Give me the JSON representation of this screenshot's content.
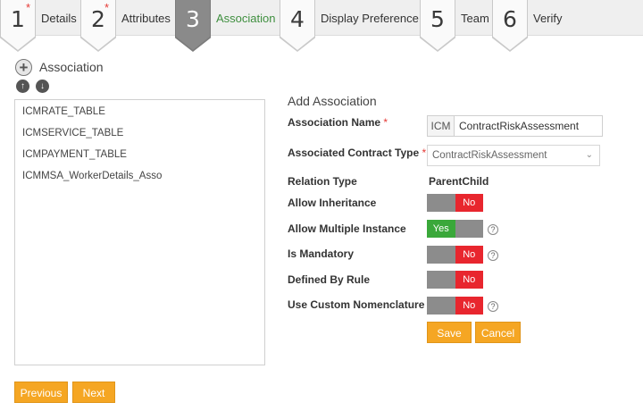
{
  "wizard": {
    "steps": [
      {
        "num": "1",
        "label": "Details",
        "required": "*"
      },
      {
        "num": "2",
        "label": "Attributes",
        "required": "*"
      },
      {
        "num": "3",
        "label": "Association",
        "required": ""
      },
      {
        "num": "4",
        "label": "Display Preference",
        "required": ""
      },
      {
        "num": "5",
        "label": "Team",
        "required": ""
      },
      {
        "num": "6",
        "label": "Verify",
        "required": ""
      }
    ],
    "active_step": "3"
  },
  "left_panel": {
    "title": "Association",
    "add_icon": "plus-circle-icon",
    "move_up_icon": "arrow-up-icon",
    "move_down_icon": "arrow-down-icon",
    "items": [
      "ICMRATE_TABLE",
      "ICMSERVICE_TABLE",
      "ICMPAYMENT_TABLE",
      "ICMMSA_WorkerDetails_Asso"
    ]
  },
  "form": {
    "title": "Add Association",
    "required_marker": "*",
    "association_name": {
      "label": "Association Name",
      "prefix": "ICM",
      "value": "ContractRiskAssessment"
    },
    "contract_type": {
      "label": "Associated Contract Type",
      "value": "ContractRiskAssessment"
    },
    "relation_type": {
      "label": "Relation Type",
      "value": "ParentChild"
    },
    "allow_inheritance": {
      "label": "Allow Inheritance",
      "value": "No"
    },
    "allow_multiple_instance": {
      "label": "Allow Multiple Instance",
      "value": "Yes"
    },
    "is_mandatory": {
      "label": "Is Mandatory",
      "value": "No"
    },
    "defined_by_rule": {
      "label": "Defined By Rule",
      "value": "No"
    },
    "use_custom_nomenclature": {
      "label": "Use Custom Nomenclature",
      "value": "No"
    },
    "help_glyph": "?",
    "save_label": "Save",
    "cancel_label": "Cancel"
  },
  "footer": {
    "previous_label": "Previous",
    "next_label": "Next"
  },
  "colors": {
    "accent_orange": "#f5a623",
    "active_step_green": "#3f8f3f",
    "toggle_no_red": "#e8262e",
    "toggle_yes_green": "#3aa83a",
    "required_red": "#e53935"
  }
}
